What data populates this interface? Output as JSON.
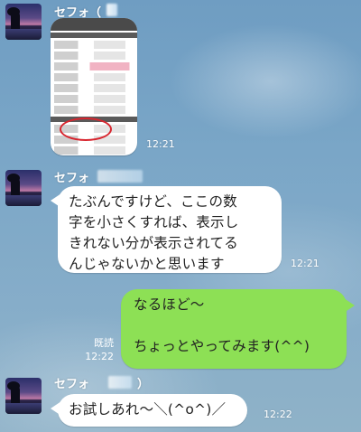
{
  "messages": [
    {
      "sender": "セフォ（",
      "kind": "image",
      "time": "12:21"
    },
    {
      "sender": "セフォ",
      "kind": "text",
      "text": "たぶんですけど、ここの数\n字を小さくすれば、表示し\nきれない分が表示されてる\nんじゃないかと思います",
      "time": "12:21"
    },
    {
      "kind": "own",
      "text": "なるほど〜\n\nちょっとやってみます(^^)",
      "read_label": "既読",
      "time": "12:22"
    },
    {
      "sender": "セフォ",
      "sender_suffix": "）",
      "kind": "text",
      "text": "お試しあれ〜＼(^o^)／",
      "time": "12:22"
    }
  ],
  "colors": {
    "own_bubble": "#8de055",
    "other_bubble": "#ffffff",
    "highlight_circle": "#d8262f"
  }
}
